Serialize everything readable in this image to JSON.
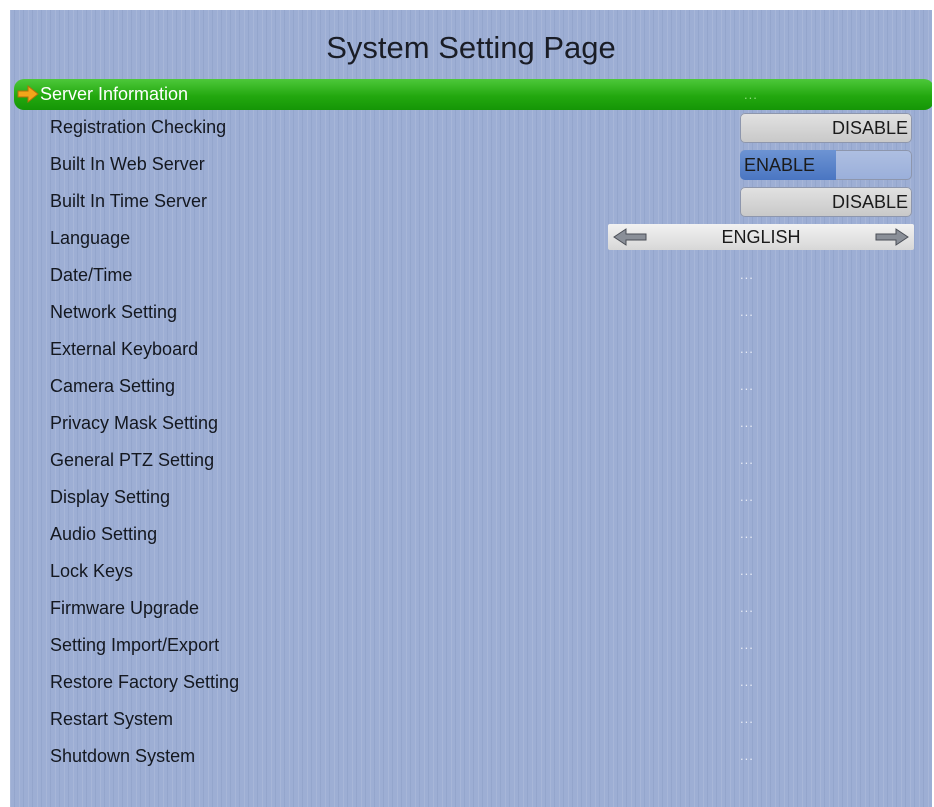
{
  "page": {
    "title": "System Setting Page"
  },
  "items": [
    {
      "label": "Server Information",
      "kind": "submenu",
      "value": "...",
      "selected": true
    },
    {
      "label": "Registration Checking",
      "kind": "toggle",
      "value": "DISABLE",
      "on": false
    },
    {
      "label": "Built In Web Server",
      "kind": "toggle",
      "value": "ENABLE",
      "on": true
    },
    {
      "label": "Built In Time Server",
      "kind": "toggle",
      "value": "DISABLE",
      "on": false
    },
    {
      "label": "Language",
      "kind": "selector",
      "value": "ENGLISH"
    },
    {
      "label": "Date/Time",
      "kind": "submenu",
      "value": "..."
    },
    {
      "label": "Network Setting",
      "kind": "submenu",
      "value": "..."
    },
    {
      "label": "External Keyboard",
      "kind": "submenu",
      "value": "..."
    },
    {
      "label": "Camera Setting",
      "kind": "submenu",
      "value": "..."
    },
    {
      "label": "Privacy Mask Setting",
      "kind": "submenu",
      "value": "..."
    },
    {
      "label": "General PTZ Setting",
      "kind": "submenu",
      "value": "..."
    },
    {
      "label": "Display Setting",
      "kind": "submenu",
      "value": "..."
    },
    {
      "label": "Audio Setting",
      "kind": "submenu",
      "value": "..."
    },
    {
      "label": "Lock Keys",
      "kind": "submenu",
      "value": "..."
    },
    {
      "label": "Firmware Upgrade",
      "kind": "submenu",
      "value": "..."
    },
    {
      "label": "Setting Import/Export",
      "kind": "submenu",
      "value": "..."
    },
    {
      "label": "Restore Factory Setting",
      "kind": "submenu",
      "value": "..."
    },
    {
      "label": "Restart System",
      "kind": "submenu",
      "value": "..."
    },
    {
      "label": "Shutdown System",
      "kind": "submenu",
      "value": "..."
    }
  ],
  "icons": {
    "cursor": "arrow-right-icon",
    "language_prev": "arrow-left-icon",
    "language_next": "arrow-right-icon"
  },
  "colors": {
    "background": "#9daed4",
    "selected_row": "#23a80f",
    "cursor_arrow": "#f2a51a",
    "toggle_on": "#4a76c2"
  }
}
